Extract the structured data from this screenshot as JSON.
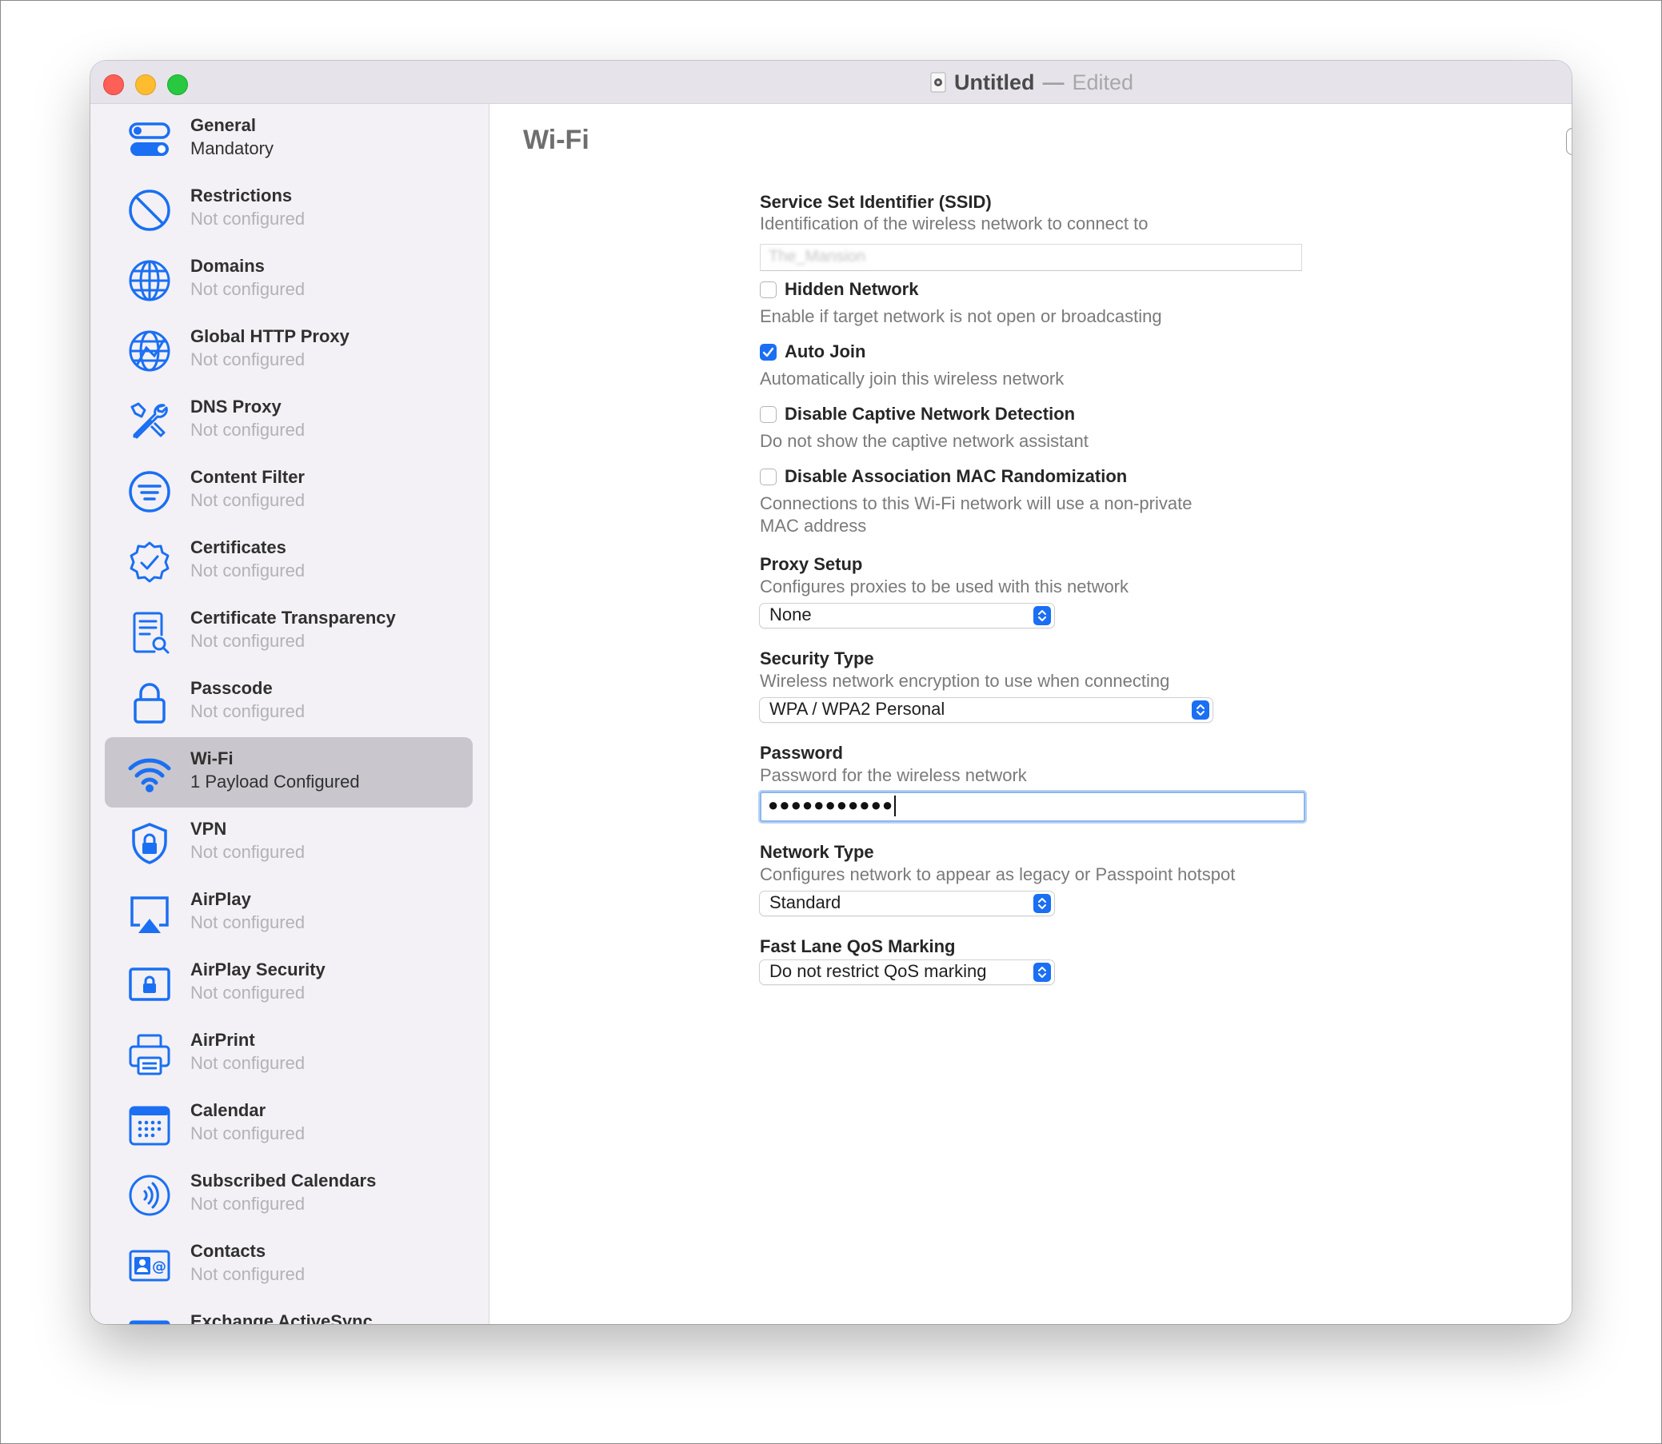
{
  "window": {
    "title": "Untitled",
    "separator": "—",
    "status": "Edited"
  },
  "sidebar": {
    "items": [
      {
        "title": "General",
        "subtitle": "Mandatory",
        "icon": "toggle-switches-icon"
      },
      {
        "title": "Restrictions",
        "subtitle": "Not configured",
        "icon": "prohibited-icon"
      },
      {
        "title": "Domains",
        "subtitle": "Not configured",
        "icon": "globe-icon"
      },
      {
        "title": "Global HTTP Proxy",
        "subtitle": "Not configured",
        "icon": "globe-network-icon"
      },
      {
        "title": "DNS Proxy",
        "subtitle": "Not configured",
        "icon": "tools-icon"
      },
      {
        "title": "Content Filter",
        "subtitle": "Not configured",
        "icon": "filter-lines-icon"
      },
      {
        "title": "Certificates",
        "subtitle": "Not configured",
        "icon": "checkmark-seal-icon"
      },
      {
        "title": "Certificate Transparency",
        "subtitle": "Not configured",
        "icon": "document-search-icon"
      },
      {
        "title": "Passcode",
        "subtitle": "Not configured",
        "icon": "lock-icon"
      },
      {
        "title": "Wi-Fi",
        "subtitle": "1 Payload Configured",
        "icon": "wifi-icon"
      },
      {
        "title": "VPN",
        "subtitle": "Not configured",
        "icon": "shield-lock-icon"
      },
      {
        "title": "AirPlay",
        "subtitle": "Not configured",
        "icon": "airplay-icon"
      },
      {
        "title": "AirPlay Security",
        "subtitle": "Not configured",
        "icon": "screen-lock-icon"
      },
      {
        "title": "AirPrint",
        "subtitle": "Not configured",
        "icon": "printer-icon"
      },
      {
        "title": "Calendar",
        "subtitle": "Not configured",
        "icon": "calendar-icon"
      },
      {
        "title": "Subscribed Calendars",
        "subtitle": "Not configured",
        "icon": "broadcast-icon"
      },
      {
        "title": "Contacts",
        "subtitle": "Not configured",
        "icon": "contact-card-icon"
      },
      {
        "title": "Exchange ActiveSync",
        "subtitle": "",
        "icon": "exchange-icon"
      }
    ]
  },
  "main": {
    "title": "Wi-Fi",
    "remove_button": "−",
    "add_button": "+",
    "ssid": {
      "label": "Service Set Identifier (SSID)",
      "description": "Identification of the wireless network to connect to",
      "value": "The_Mansion"
    },
    "hidden_network": {
      "label": "Hidden Network",
      "description": "Enable if target network is not open or broadcasting",
      "checked": false
    },
    "auto_join": {
      "label": "Auto Join",
      "description": "Automatically join this wireless network",
      "checked": true
    },
    "captive": {
      "label": "Disable Captive Network Detection",
      "description": "Do not show the captive network assistant",
      "checked": false
    },
    "mac_random": {
      "label": "Disable Association MAC Randomization",
      "description_line1": "Connections to this Wi-Fi network will use a non-private",
      "description_line2": "MAC address",
      "checked": false
    },
    "proxy": {
      "label": "Proxy Setup",
      "description": "Configures proxies to be used with this network",
      "value": "None"
    },
    "security": {
      "label": "Security Type",
      "description": "Wireless network encryption to use when connecting",
      "value": "WPA / WPA2 Personal"
    },
    "password": {
      "label": "Password",
      "description": "Password for the wireless network",
      "value": "●●●●●●●●●●●"
    },
    "network_type": {
      "label": "Network Type",
      "description": "Configures network to appear as legacy or Passpoint hotspot",
      "value": "Standard"
    },
    "qos": {
      "label": "Fast Lane QoS Marking",
      "value": "Do not restrict QoS marking"
    }
  },
  "colors": {
    "accent": "#1a6ff3",
    "selection": "#c9c7cd",
    "sidebar_bg": "#f3f1f5"
  }
}
